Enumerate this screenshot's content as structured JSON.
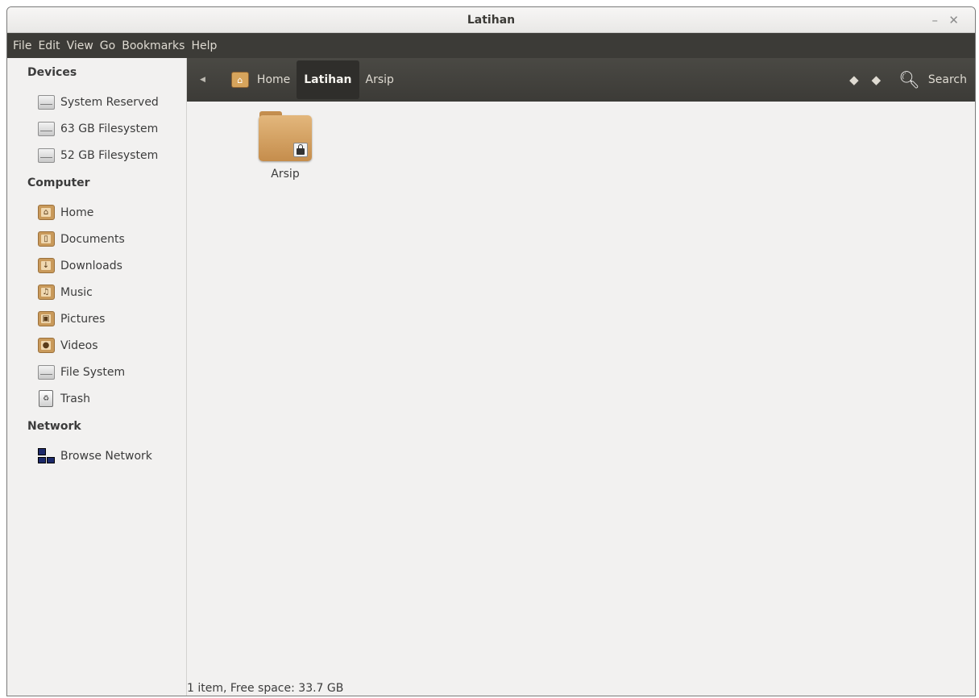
{
  "window": {
    "title": "Latihan"
  },
  "menu": [
    "File",
    "Edit",
    "View",
    "Go",
    "Bookmarks",
    "Help"
  ],
  "sidebar": {
    "sections": [
      {
        "title": "Devices",
        "items": [
          {
            "label": "System Reserved",
            "icon": "drive-icon"
          },
          {
            "label": "63 GB Filesystem",
            "icon": "drive-icon"
          },
          {
            "label": "52 GB Filesystem",
            "icon": "drive-icon"
          }
        ]
      },
      {
        "title": "Computer",
        "items": [
          {
            "label": "Home",
            "icon": "home-folder-icon"
          },
          {
            "label": "Documents",
            "icon": "documents-folder-icon"
          },
          {
            "label": "Downloads",
            "icon": "downloads-folder-icon"
          },
          {
            "label": "Music",
            "icon": "music-folder-icon"
          },
          {
            "label": "Pictures",
            "icon": "pictures-folder-icon"
          },
          {
            "label": "Videos",
            "icon": "videos-folder-icon"
          },
          {
            "label": "File System",
            "icon": "drive-icon"
          },
          {
            "label": "Trash",
            "icon": "trash-icon"
          }
        ]
      },
      {
        "title": "Network",
        "items": [
          {
            "label": "Browse Network",
            "icon": "network-icon"
          }
        ]
      }
    ]
  },
  "pathbar": {
    "crumbs": [
      {
        "label": "Home",
        "active": false
      },
      {
        "label": "Latihan",
        "active": true
      },
      {
        "label": "Arsip",
        "active": false
      }
    ],
    "search_label": "Search"
  },
  "files": [
    {
      "name": "Arsip",
      "locked": true
    }
  ],
  "status": "1 item, Free space: 33.7 GB"
}
